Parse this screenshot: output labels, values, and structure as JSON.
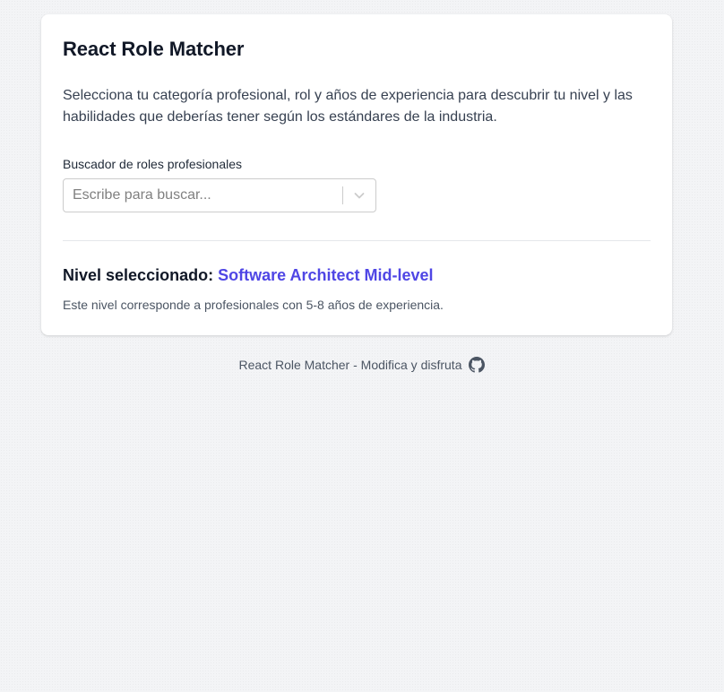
{
  "app": {
    "title": "React Role Matcher",
    "description": "Selecciona tu categoría profesional, rol y años de experiencia para descubrir tu nivel y las habilidades que deberías tener según los estándares de la industria."
  },
  "search": {
    "label": "Buscador de roles profesionales",
    "placeholder": "Escribe para buscar...",
    "value": "",
    "dropdown_icon": "chevron-down-icon"
  },
  "selection": {
    "prefix": "Nivel seleccionado:",
    "level": "Software Architect Mid-level",
    "note": "Este nivel corresponde a profesionales con 5-8 años de experiencia."
  },
  "footer": {
    "text": "React Role Matcher - Modifica y disfruta",
    "icon": "github-icon"
  },
  "colors": {
    "accent": "#4f46e5",
    "background": "#f3f4f6",
    "card": "#ffffff"
  }
}
